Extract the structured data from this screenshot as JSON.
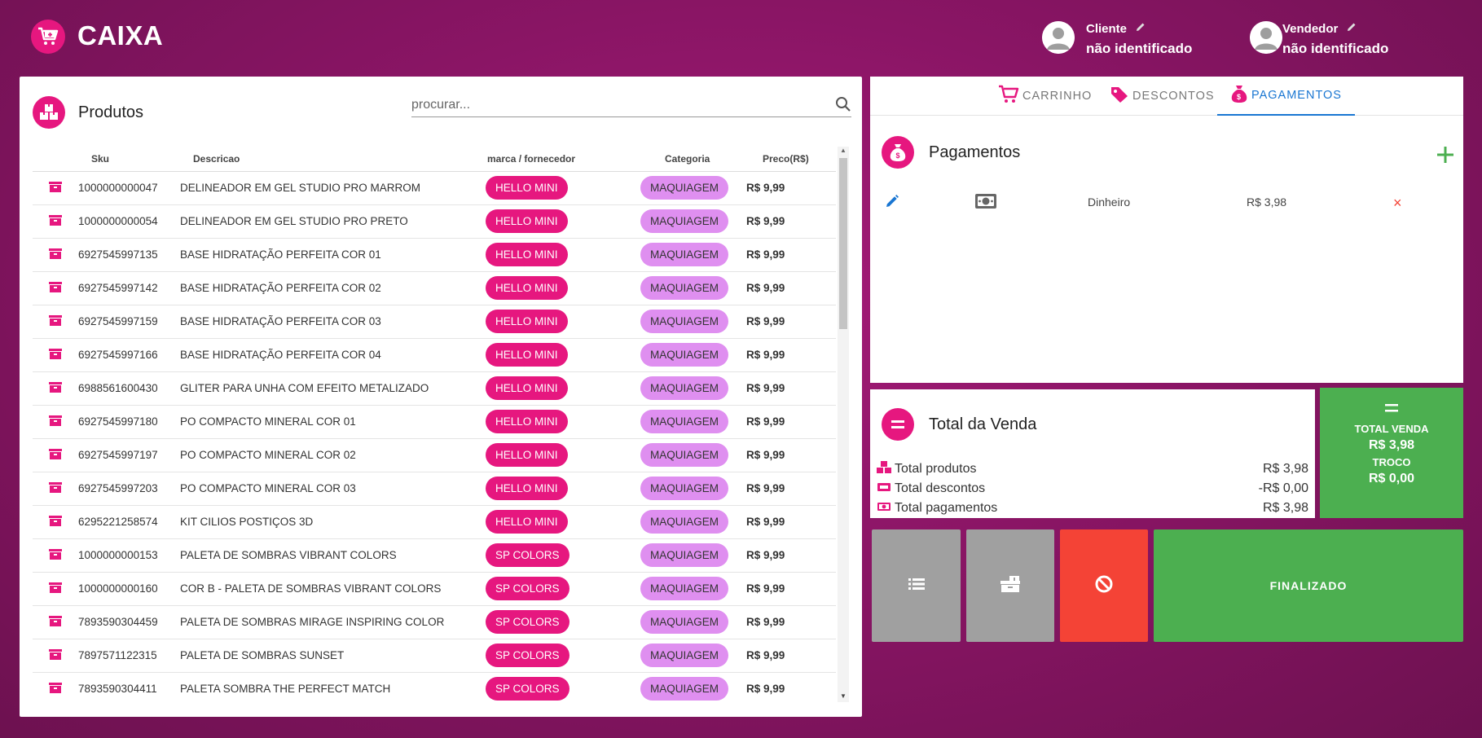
{
  "header": {
    "title": "CAIXA",
    "cliente": {
      "role": "Cliente",
      "name": "não identificado"
    },
    "vendedor": {
      "role": "Vendedor",
      "name": "não identificado"
    }
  },
  "products": {
    "title": "Produtos",
    "search_placeholder": "procurar...",
    "columns": [
      "Sku",
      "Descricao",
      "marca / fornecedor",
      "Categoria",
      "Preco(R$)"
    ],
    "rows": [
      {
        "sku": "1000000000047",
        "desc": "DELINEADOR EM GEL STUDIO PRO MARROM",
        "brand": "HELLO MINI",
        "cat": "MAQUIAGEM",
        "price": "R$ 9,99"
      },
      {
        "sku": "1000000000054",
        "desc": "DELINEADOR EM GEL STUDIO PRO PRETO",
        "brand": "HELLO MINI",
        "cat": "MAQUIAGEM",
        "price": "R$ 9,99"
      },
      {
        "sku": "6927545997135",
        "desc": "BASE HIDRATAÇÃO PERFEITA COR 01",
        "brand": "HELLO MINI",
        "cat": "MAQUIAGEM",
        "price": "R$ 9,99"
      },
      {
        "sku": "6927545997142",
        "desc": "BASE HIDRATAÇÃO PERFEITA COR 02",
        "brand": "HELLO MINI",
        "cat": "MAQUIAGEM",
        "price": "R$ 9,99"
      },
      {
        "sku": "6927545997159",
        "desc": "BASE HIDRATAÇÃO PERFEITA COR 03",
        "brand": "HELLO MINI",
        "cat": "MAQUIAGEM",
        "price": "R$ 9,99"
      },
      {
        "sku": "6927545997166",
        "desc": "BASE HIDRATAÇÃO PERFEITA COR 04",
        "brand": "HELLO MINI",
        "cat": "MAQUIAGEM",
        "price": "R$ 9,99"
      },
      {
        "sku": "6988561600430",
        "desc": "GLITER PARA UNHA COM EFEITO METALIZADO",
        "brand": "HELLO MINI",
        "cat": "MAQUIAGEM",
        "price": "R$ 9,99"
      },
      {
        "sku": "6927545997180",
        "desc": "PO COMPACTO MINERAL COR 01",
        "brand": "HELLO MINI",
        "cat": "MAQUIAGEM",
        "price": "R$ 9,99"
      },
      {
        "sku": "6927545997197",
        "desc": "PO COMPACTO MINERAL COR 02",
        "brand": "HELLO MINI",
        "cat": "MAQUIAGEM",
        "price": "R$ 9,99"
      },
      {
        "sku": "6927545997203",
        "desc": "PO COMPACTO MINERAL COR 03",
        "brand": "HELLO MINI",
        "cat": "MAQUIAGEM",
        "price": "R$ 9,99"
      },
      {
        "sku": "6295221258574",
        "desc": "KIT CILIOS POSTIÇOS 3D",
        "brand": "HELLO MINI",
        "cat": "MAQUIAGEM",
        "price": "R$ 9,99"
      },
      {
        "sku": "1000000000153",
        "desc": "PALETA DE SOMBRAS VIBRANT COLORS",
        "brand": "SP COLORS",
        "cat": "MAQUIAGEM",
        "price": "R$ 9,99"
      },
      {
        "sku": "1000000000160",
        "desc": "COR B - PALETA DE SOMBRAS VIBRANT COLORS",
        "brand": "SP COLORS",
        "cat": "MAQUIAGEM",
        "price": "R$ 9,99"
      },
      {
        "sku": "7893590304459",
        "desc": "PALETA DE SOMBRAS MIRAGE INSPIRING COLOR",
        "brand": "SP COLORS",
        "cat": "MAQUIAGEM",
        "price": "R$ 9,99"
      },
      {
        "sku": "7897571122315",
        "desc": "PALETA DE SOMBRAS SUNSET",
        "brand": "SP COLORS",
        "cat": "MAQUIAGEM",
        "price": "R$ 9,99"
      },
      {
        "sku": "7893590304411",
        "desc": "PALETA SOMBRA THE PERFECT MATCH",
        "brand": "SP COLORS",
        "cat": "MAQUIAGEM",
        "price": "R$ 9,99"
      }
    ]
  },
  "tabs": [
    {
      "label": "CARRINHO",
      "icon": "cart-icon"
    },
    {
      "label": "DESCONTOS",
      "icon": "tag-icon"
    },
    {
      "label": "PAGAMENTOS",
      "icon": "money-bag-icon",
      "active": true
    }
  ],
  "payments": {
    "title": "Pagamentos",
    "items": [
      {
        "method": "Dinheiro",
        "amount": "R$ 3,98"
      }
    ]
  },
  "totals": {
    "title": "Total da Venda",
    "produtos_label": "Total produtos",
    "produtos_value": "R$ 3,98",
    "descontos_label": "Total descontos",
    "descontos_value": "-R$ 0,00",
    "pagamentos_label": "Total pagamentos",
    "pagamentos_value": "R$ 3,98"
  },
  "summary": {
    "total_label": "TOTAL VENDA",
    "total_value": "R$ 3,98",
    "troco_label": "TROCO",
    "troco_value": "R$ 0,00"
  },
  "actions": {
    "finalize_label": "FINALIZADO"
  },
  "colors": {
    "accent": "#e6177f",
    "category": "#df8ff0",
    "success": "#4caf50",
    "danger": "#f44336",
    "neutral": "#a0a0a0",
    "tab_active": "#1976d2"
  }
}
